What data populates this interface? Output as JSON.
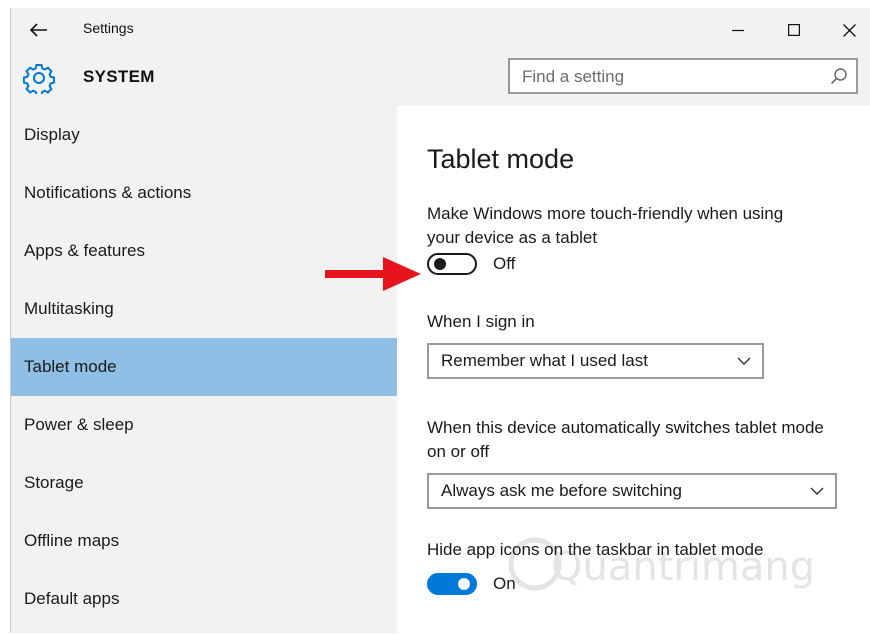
{
  "window": {
    "app_title": "Settings",
    "section_title": "SYSTEM"
  },
  "search": {
    "placeholder": "Find a setting"
  },
  "sidebar": {
    "items": [
      {
        "label": "Display",
        "selected": false
      },
      {
        "label": "Notifications & actions",
        "selected": false
      },
      {
        "label": "Apps & features",
        "selected": false
      },
      {
        "label": "Multitasking",
        "selected": false
      },
      {
        "label": "Tablet mode",
        "selected": true
      },
      {
        "label": "Power & sleep",
        "selected": false
      },
      {
        "label": "Storage",
        "selected": false
      },
      {
        "label": "Offline maps",
        "selected": false
      },
      {
        "label": "Default apps",
        "selected": false
      }
    ]
  },
  "main": {
    "title": "Tablet mode",
    "touch_friendly": {
      "description_line1": "Make Windows more touch-friendly when using",
      "description_line2": "your device as a tablet",
      "toggle_state": "Off"
    },
    "sign_in": {
      "label": "When I sign in",
      "selected": "Remember what I used last"
    },
    "auto_switch": {
      "label_line1": "When this device automatically switches tablet mode",
      "label_line2": "on or off",
      "selected": "Always ask me before switching"
    },
    "hide_icons": {
      "label": "Hide app icons on the taskbar in tablet mode",
      "toggle_state": "On"
    }
  },
  "icons": {
    "back": "back-arrow-icon",
    "minimize": "minimize-icon",
    "maximize": "maximize-icon",
    "close": "close-icon",
    "system": "gear-icon",
    "search": "search-icon",
    "dropdown": "chevron-down-icon",
    "annotation": "red-arrow-icon"
  },
  "watermark": "Quantrimang",
  "colors": {
    "accent": "#0078d7",
    "selected_nav": "#8fbfe5",
    "sidebar_bg": "#f2f2f2",
    "annotation_arrow": "#e8141b"
  }
}
